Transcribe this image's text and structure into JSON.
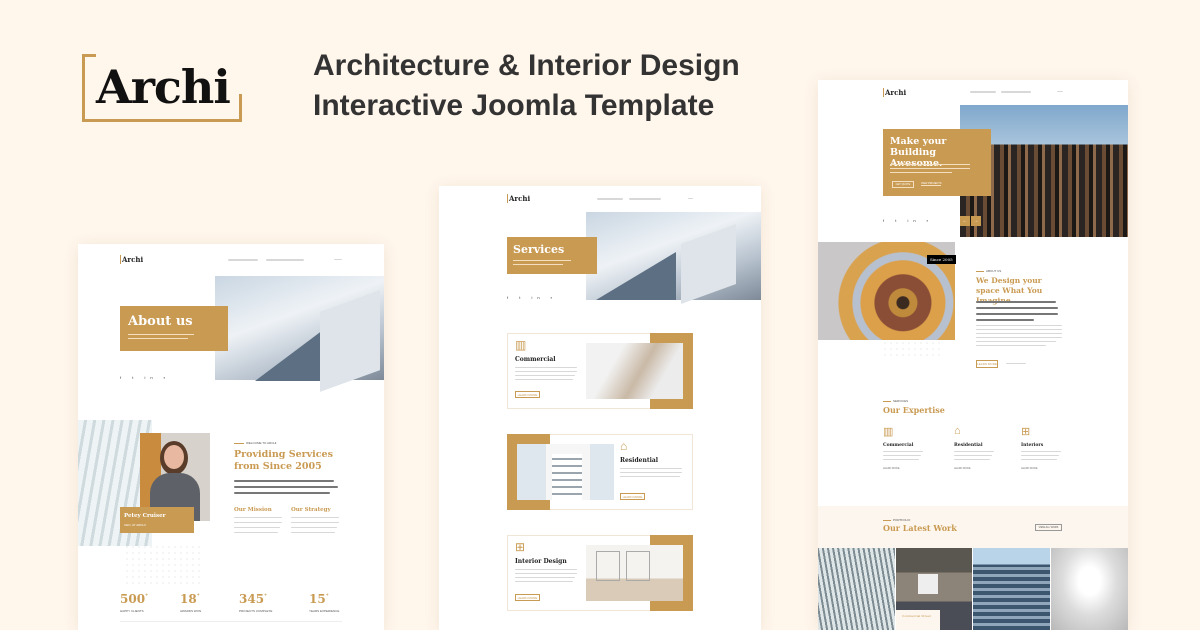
{
  "brand": {
    "logo": "Archi",
    "accent": "#c99a52",
    "background": "#fff6ec"
  },
  "headline": {
    "line1": "Architecture & Interior Design",
    "line2": "Interactive Joomla Template"
  },
  "about_page": {
    "logo": "Archi",
    "hero_title": "About us",
    "welcome": "WELCOME TO ARCHI",
    "heading": "Providing Services from Since 2005",
    "person_name": "Petey Cruiser",
    "person_role": "CEO, AT ARCHI",
    "mission": "Our Mission",
    "strategy": "Our Strategy",
    "stats": [
      {
        "value": "500",
        "label": "HAPPY CLIENTS"
      },
      {
        "value": "18",
        "label": "AWARDS WON"
      },
      {
        "value": "345",
        "label": "PROJECTS COMPLETE"
      },
      {
        "value": "15",
        "label": "YEARS EXPERIENCE"
      }
    ]
  },
  "services_page": {
    "logo": "Archi",
    "hero_title": "Services",
    "items": [
      {
        "title": "Commercial",
        "button": "LEARN MORE"
      },
      {
        "title": "Residential",
        "button": "LEARN MORE"
      },
      {
        "title": "Interior Design",
        "button": "LEARN MORE"
      }
    ]
  },
  "home_page": {
    "logo": "Archi",
    "hero_title": "Make your Building Awesome.",
    "hero_btn1": "GET QUOTE",
    "hero_btn2": "VIEW PROJECTS",
    "since_badge": "Since 2005",
    "about_label": "ABOUT US",
    "about_heading": "We Design your space What You Imagine.",
    "about_btn": "LEARN MORE",
    "services_label": "SERVICES",
    "expertise_heading": "Our Expertise",
    "expertise": [
      {
        "title": "Commercial",
        "link": "LEARN MORE"
      },
      {
        "title": "Residential",
        "link": "LEARN MORE"
      },
      {
        "title": "Interiors",
        "link": "LEARN MORE"
      }
    ],
    "portfolio_label": "PORTFOLIO",
    "work_heading": "Our Latest Work",
    "work_button": "VIEW ALL WORK",
    "work_caption": "Commercial Street"
  }
}
